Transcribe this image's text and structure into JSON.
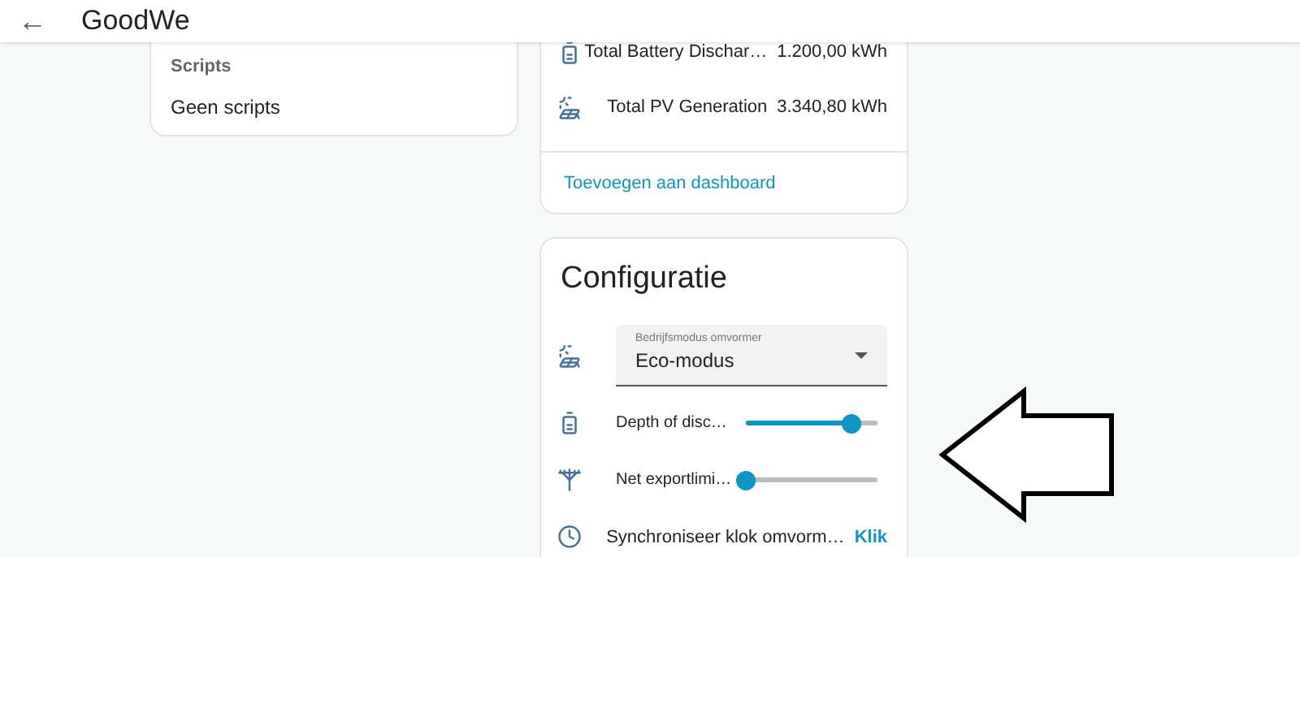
{
  "header": {
    "back_icon": "←",
    "title": "GoodWe"
  },
  "scripts_card": {
    "heading": "Scripts",
    "empty_text": "Geen scripts"
  },
  "energy_card": {
    "rows": [
      {
        "kind": "battery",
        "label": "Total Battery Dischar…",
        "value": "1.200,00 kWh"
      },
      {
        "kind": "solar",
        "label": "Total PV Generation",
        "value": "3.340,80 kWh"
      }
    ],
    "action": "Toevoegen aan dashboard"
  },
  "config_card": {
    "title": "Configuratie",
    "rows": [
      {
        "kind": "select",
        "label": "Bedrijfsmodus omvormer",
        "value": "Eco-modus"
      },
      {
        "kind": "slider",
        "label": "Depth of disc…",
        "level": 0.8
      },
      {
        "kind": "slider",
        "label": "Net exportlimi…",
        "level": 0
      },
      {
        "kind": "button",
        "label": "Synchroniseer klok omvorm…",
        "action": "Klik"
      }
    ]
  },
  "annotation": {
    "kind": "arrow"
  }
}
